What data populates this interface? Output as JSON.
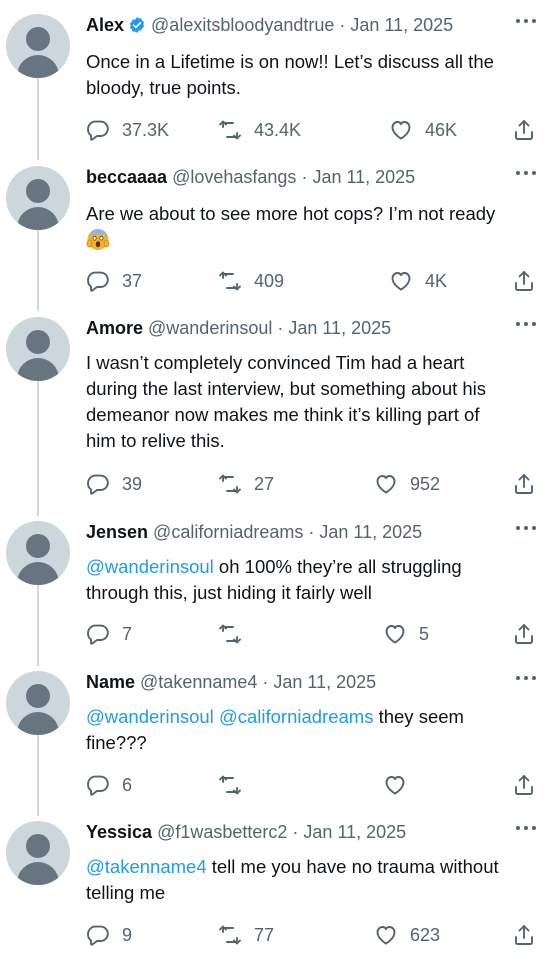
{
  "colors": {
    "accent": "#1d9bf0",
    "secondary_text": "#536471",
    "thread_line": "#cfd9de",
    "avatar_bg": "#ccd6dd"
  },
  "icons": {
    "reply": "reply-icon",
    "retweet": "retweet-icon",
    "like": "heart-icon",
    "share": "share-icon",
    "more": "more-icon",
    "verified": "verified-badge-icon"
  },
  "tweets": [
    {
      "name": "Alex",
      "handle": "@alexitsbloodyandtrue",
      "sep": "·",
      "date": "Jan 11, 2025",
      "text_line1": "Once in a Lifetime is on now!! Let’s discuss all the",
      "text_line2": "bloody, true points.",
      "replies": "37.3K",
      "retweets": "43.4K",
      "likes": "46K"
    },
    {
      "name": "beccaaaa",
      "handle": "@lovehasfangs",
      "sep": "·",
      "date": "Jan 11, 2025",
      "text_line1": "Are we about to see more hot cops? I’m not ready",
      "emoji": "face-screaming-emoji",
      "replies": "37",
      "retweets": "409",
      "likes": "4K"
    },
    {
      "name": "Amore",
      "handle": "@wanderinsoul",
      "sep": "·",
      "date": "Jan 11, 2025",
      "text_line1": "I wasn’t completely convinced Tim had a heart",
      "text_line2": "during the last interview, but something about his",
      "text_line3": "demeanor now makes me think it’s killing part of",
      "text_line4": "him to relive this.",
      "replies": "39",
      "retweets": "27",
      "likes": "952"
    },
    {
      "name": "Jensen",
      "handle": "@californiadreams",
      "sep": "·",
      "date": "Jan 11, 2025",
      "mention1": "@wanderinsoul",
      "text_line1": " oh 100% they’re all struggling",
      "text_line2": "through this, just hiding it fairly well",
      "replies": "7",
      "retweets": "",
      "likes": "5"
    },
    {
      "name": "Name",
      "handle": "@takenname4",
      "sep": "·",
      "date": "Jan 11, 2025",
      "mention1": "@wanderinsoul",
      "mention2": "@californiadreams",
      "text_line1": " they seem",
      "text_line2": "fine???",
      "replies": "6",
      "retweets": "",
      "likes": ""
    },
    {
      "name": "Yessica",
      "handle": "@f1wasbetterc2",
      "sep": "·",
      "date": "Jan 11, 2025",
      "mention1": "@takenname4",
      "text_line1": " tell me you have no trauma without",
      "text_line2": "telling me",
      "replies": "9",
      "retweets": "77",
      "likes": "623"
    }
  ]
}
